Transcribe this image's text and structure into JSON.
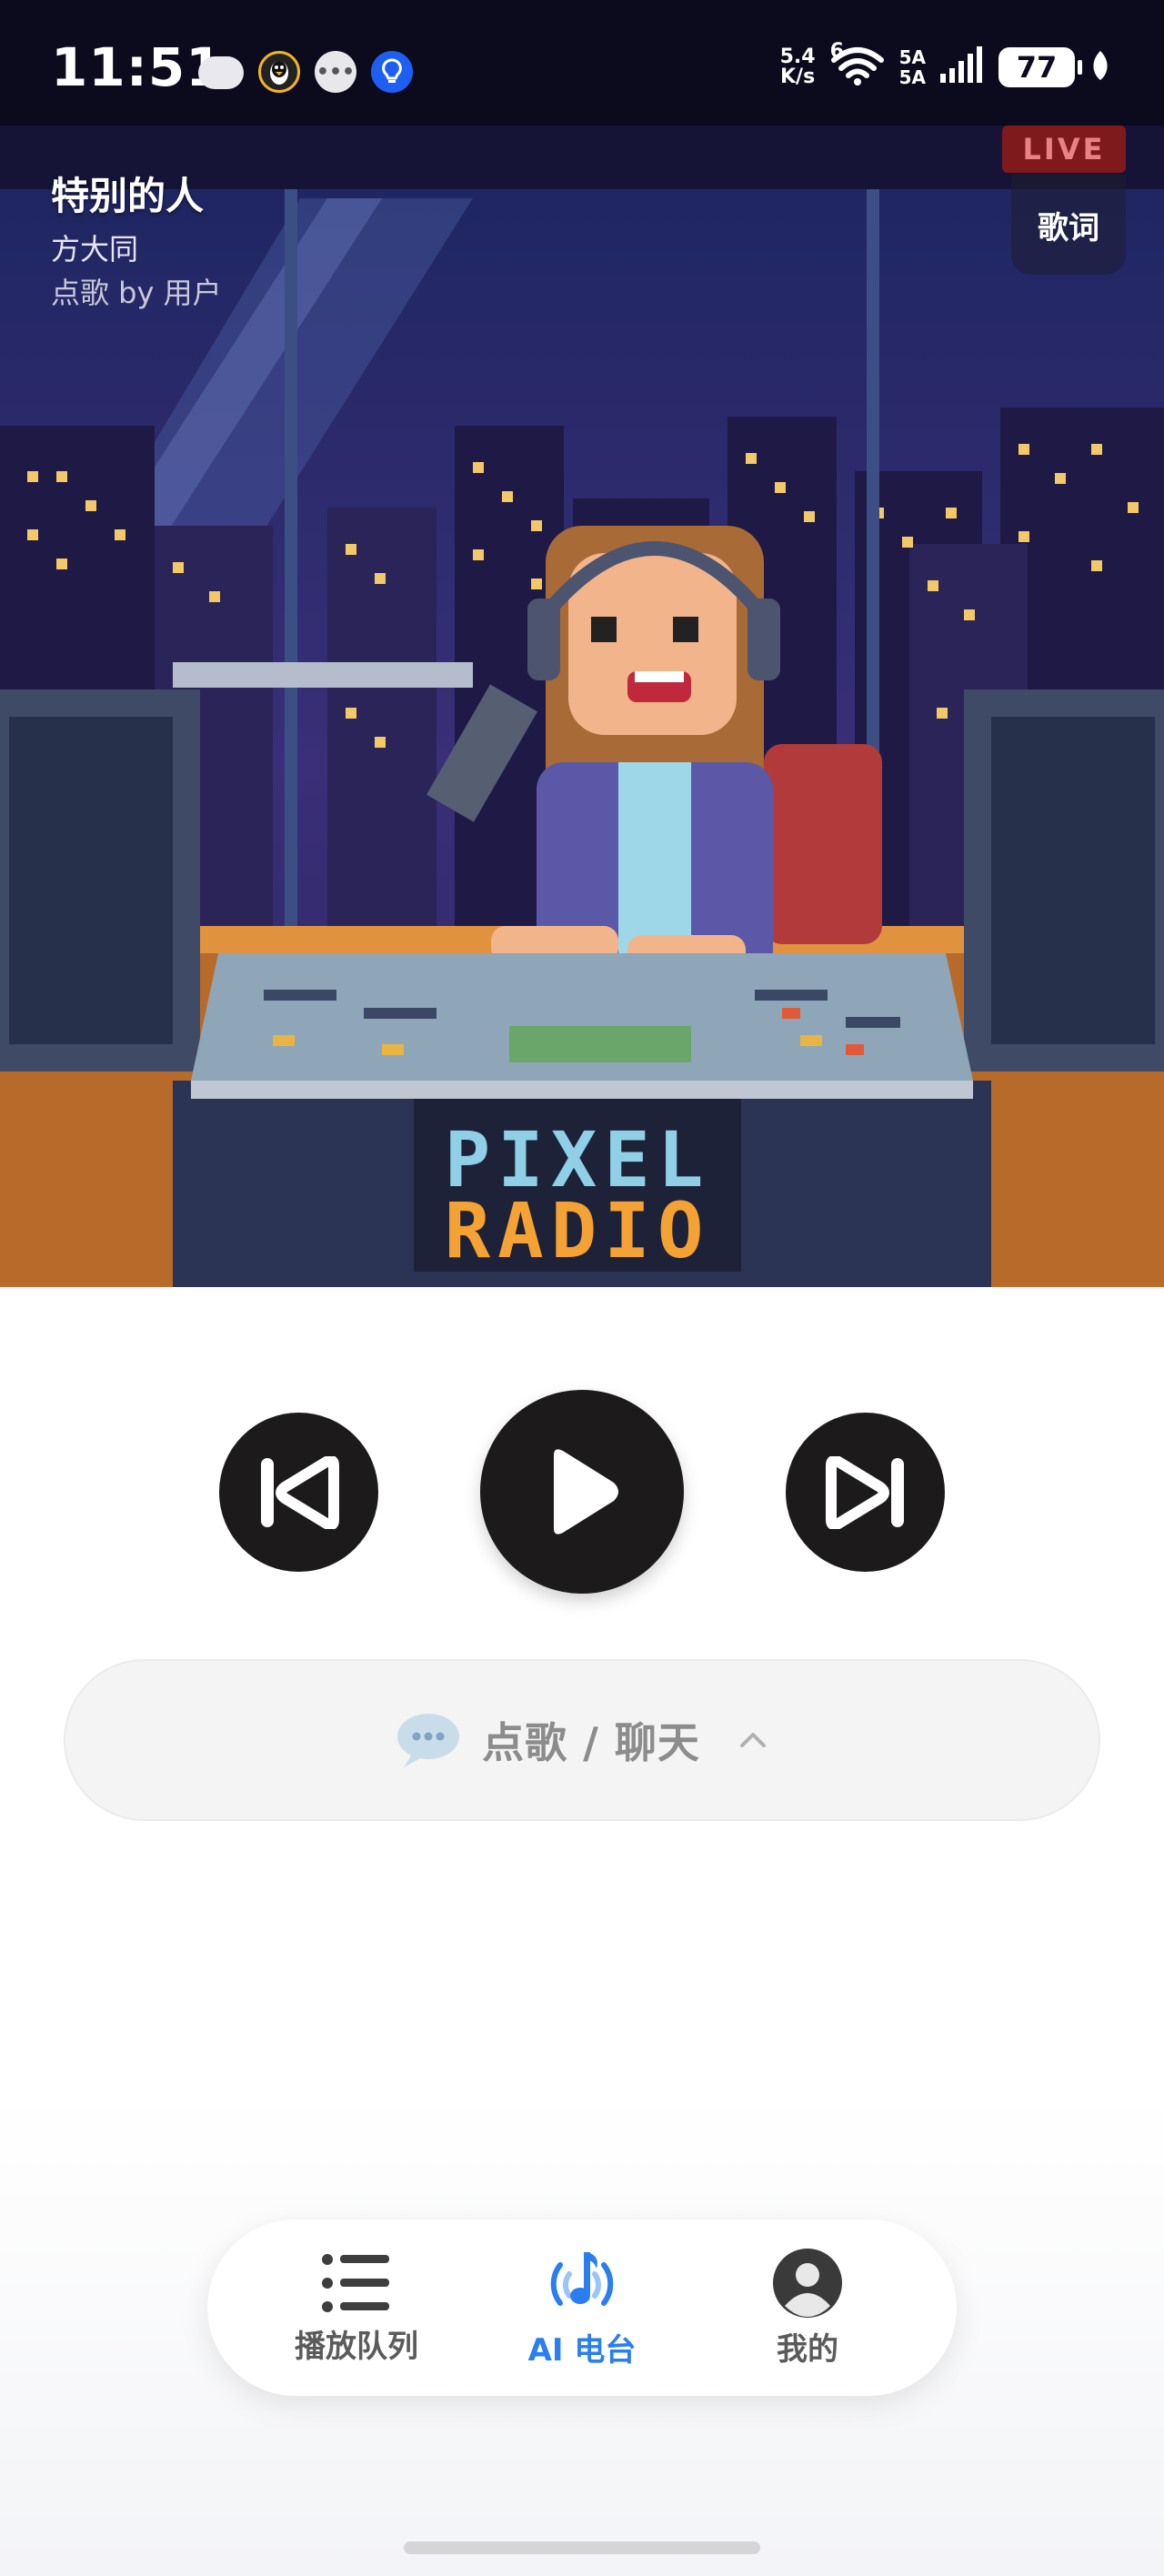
{
  "status_bar": {
    "time": "11:51",
    "net_speed_value": "5.4",
    "net_speed_unit": "K/s",
    "network_type": "6",
    "sim_1": "5A",
    "sim_2": "5A",
    "battery_level": "77",
    "icons": [
      "weather-cloud-icon",
      "qq-penguin-icon",
      "wechat-icon",
      "lightbulb-icon",
      "wifi-icon",
      "signal-icon",
      "battery-icon",
      "leaf-icon"
    ]
  },
  "now_playing": {
    "title": "特别的人",
    "artist": "方大同",
    "requested_by": "点歌 by 用户",
    "live_label": "LIVE",
    "lyrics_label": "歌词",
    "artwork_text_line1": "PIXEL",
    "artwork_text_line2": "RADIO"
  },
  "controls": {
    "previous_icon": "skip-previous-icon",
    "play_icon": "play-icon",
    "next_icon": "skip-next-icon"
  },
  "chat_bar": {
    "label": "点歌 / 聊天",
    "icon": "chat-bubble-icon",
    "expand_icon": "chevron-up-icon"
  },
  "bottom_nav": {
    "items": [
      {
        "label": "播放队列",
        "icon": "list-icon",
        "active": false
      },
      {
        "label": "AI 电台",
        "icon": "radio-music-icon",
        "active": true
      },
      {
        "label": "我的",
        "icon": "profile-icon",
        "active": false
      }
    ]
  },
  "colors": {
    "accent": "#2a7ef0",
    "control_fill": "#1c1a1a",
    "status_bar_bg": "#0c0b1e",
    "live_badge": "#8a1a1a"
  }
}
